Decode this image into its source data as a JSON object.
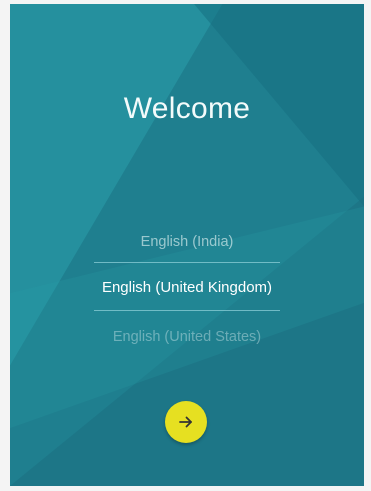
{
  "welcome": {
    "title": "Welcome"
  },
  "language_picker": {
    "previous": "English (India)",
    "selected": "English (United Kingdom)",
    "next": "English (United States)"
  },
  "next_button": {
    "icon": "arrow-right-icon",
    "color": "#e6e021"
  },
  "colors": {
    "background": "#1f7f8f",
    "text": "#ffffff"
  }
}
